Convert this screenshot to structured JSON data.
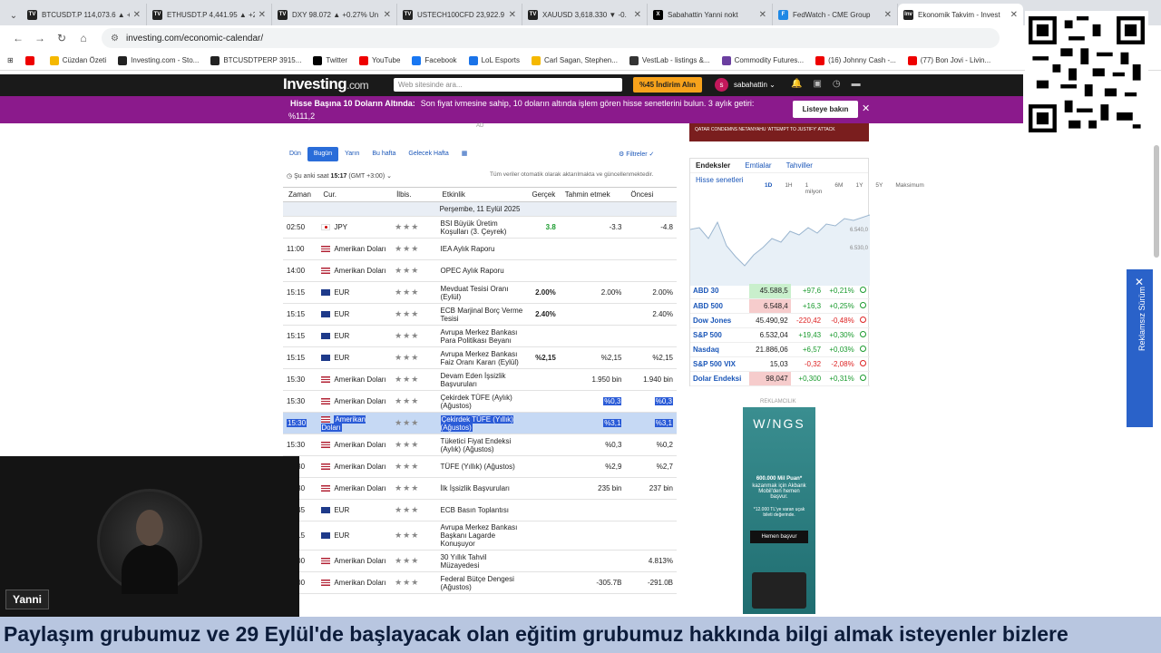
{
  "browser": {
    "tabs": [
      {
        "label": "BTCUSDT.P 114,073.6 ▲ +0.",
        "fav": "TV",
        "color": "#222"
      },
      {
        "label": "ETHUSDT.P 4,441.95 ▲ +2.",
        "fav": "TV",
        "color": "#222"
      },
      {
        "label": "DXY 98.072 ▲ +0.27% Un",
        "fav": "TV",
        "color": "#222"
      },
      {
        "label": "USTECH100CFD 23,922.9",
        "fav": "TV",
        "color": "#222"
      },
      {
        "label": "XAUUSD 3,618.330 ▼ -0.",
        "fav": "TV",
        "color": "#222"
      },
      {
        "label": "Sabahattin Yanni nokt",
        "fav": "X",
        "color": "#000"
      },
      {
        "label": "FedWatch - CME Group",
        "fav": "F",
        "color": "#1e88e5"
      },
      {
        "label": "Ekonomik Takvim - Invest",
        "fav": "Inv",
        "color": "#222"
      }
    ],
    "url": "investing.com/economic-calendar/",
    "bookmarks": [
      {
        "label": "",
        "color": "#e00"
      },
      {
        "label": "Cüzdan Özeti",
        "color": "#f5b800"
      },
      {
        "label": "Investing.com - Sto...",
        "color": "#222"
      },
      {
        "label": "BTCUSDTPERP 3915...",
        "color": "#222"
      },
      {
        "label": "Twitter",
        "color": "#000"
      },
      {
        "label": "YouTube",
        "color": "#e00"
      },
      {
        "label": "Facebook",
        "color": "#1877f2"
      },
      {
        "label": "LoL Esports",
        "color": "#1a73e8"
      },
      {
        "label": "Carl Sagan, Stephen...",
        "color": "#f5b800"
      },
      {
        "label": "VestLab - listings &...",
        "color": "#333"
      },
      {
        "label": "Commodity Futures...",
        "color": "#6b3fa0"
      },
      {
        "label": "(16) Johnny Cash -...",
        "color": "#e00"
      },
      {
        "label": "(77) Bon Jovi - Livin...",
        "color": "#e00"
      }
    ]
  },
  "header": {
    "logo": "Investing",
    "logo_suffix": ".com",
    "search_placeholder": "Web sitesinde ara...",
    "promo": "%45 İndirim Alın",
    "user_initial": "s",
    "user": "sabahattin ⌄"
  },
  "banner": {
    "title": "Hisse Başına 10 Doların Altında:",
    "text": "Son fiyat ivmesine sahip, 10 doların altında işlem gören hisse senetlerini bulun. 3 aylık getiri:",
    "value": "%111,2",
    "button": "Listeye bakın"
  },
  "calendar": {
    "ad_label": "AD",
    "filters": [
      "Dün",
      "Bugün",
      "Yarın",
      "Bu hafta",
      "Gelecek Hafta"
    ],
    "filter_button": "Filtreler",
    "clock_label": "Şu anki saat",
    "clock_time": "15:17",
    "timezone": "(GMT +3:00)",
    "note": "Tüm veriler otomatik olarak aktarılmakta ve güncellenmektedir.",
    "headers": [
      "Zaman",
      "Cur.",
      "İlbis.",
      "Etkinlik",
      "Gerçek",
      "Tahmin etmek",
      "Öncesi"
    ],
    "date": "Perşembe, 11 Eylül 2025",
    "rows": [
      {
        "time": "02:50",
        "flag": "jp",
        "cur": "JPY",
        "event": "BSI Büyük Üretim Koşulları (3. Çeyrek)",
        "actual": "3.8",
        "forecast": "-3.3",
        "previous": "-4.8",
        "green": true
      },
      {
        "time": "11:00",
        "flag": "us",
        "cur": "Amerikan Doları",
        "event": "IEA Aylık Raporu",
        "actual": "",
        "forecast": "",
        "previous": ""
      },
      {
        "time": "14:00",
        "flag": "us",
        "cur": "Amerikan Doları",
        "event": "OPEC Aylık Raporu",
        "actual": "",
        "forecast": "",
        "previous": ""
      },
      {
        "time": "15:15",
        "flag": "eu",
        "cur": "EUR",
        "event": "Mevduat Tesisi Oranı (Eylül)",
        "actual": "2.00%",
        "forecast": "2.00%",
        "previous": "2.00%"
      },
      {
        "time": "15:15",
        "flag": "eu",
        "cur": "EUR",
        "event": "ECB Marjinal Borç Verme Tesisi",
        "actual": "2.40%",
        "forecast": "",
        "previous": "2.40%"
      },
      {
        "time": "15:15",
        "flag": "eu",
        "cur": "EUR",
        "event": "Avrupa Merkez Bankası Para Politikası Beyanı",
        "actual": "",
        "forecast": "",
        "previous": ""
      },
      {
        "time": "15:15",
        "flag": "eu",
        "cur": "EUR",
        "event": "Avrupa Merkez Bankası Faiz Oranı Kararı (Eylül)",
        "actual": "%2,15",
        "forecast": "%2,15",
        "previous": "%2,15"
      },
      {
        "time": "15:30",
        "flag": "us",
        "cur": "Amerikan Doları",
        "event": "Devam Eden İşsizlik Başvuruları",
        "actual": "",
        "forecast": "1.950 bin",
        "previous": "1.940 bin"
      },
      {
        "time": "15:30",
        "flag": "us",
        "cur": "Amerikan Doları",
        "event": "Çekirdek TÜFE (Aylık) (Ağustos)",
        "actual": "",
        "forecast": "%0,3",
        "previous": "%0,3"
      },
      {
        "time": "15:30",
        "flag": "us",
        "cur": "Amerikan Doları",
        "event": "Çekirdek TÜFE (Yıllık) (Ağustos)",
        "actual": "",
        "forecast": "%3,1",
        "previous": "%3,1",
        "hl": true
      },
      {
        "time": "15:30",
        "flag": "us",
        "cur": "Amerikan Doları",
        "event": "Tüketici Fiyat Endeksi (Aylık) (Ağustos)",
        "actual": "",
        "forecast": "%0,3",
        "previous": "%0,2"
      },
      {
        "time": "15:30",
        "flag": "us",
        "cur": "Amerikan Doları",
        "event": "TÜFE (Yıllık) (Ağustos)",
        "actual": "",
        "forecast": "%2,9",
        "previous": "%2,7"
      },
      {
        "time": "15:30",
        "flag": "us",
        "cur": "Amerikan Doları",
        "event": "İlk İşsizlik Başvuruları",
        "actual": "",
        "forecast": "235 bin",
        "previous": "237 bin"
      },
      {
        "time": "15:45",
        "flag": "eu",
        "cur": "EUR",
        "event": "ECB Basın Toplantısı",
        "actual": "",
        "forecast": "",
        "previous": ""
      },
      {
        "time": "16:15",
        "flag": "eu",
        "cur": "EUR",
        "event": "Avrupa Merkez Bankası Başkanı Lagarde Konuşuyor",
        "actual": "",
        "forecast": "",
        "previous": ""
      },
      {
        "time": "20:00",
        "flag": "us",
        "cur": "Amerikan Doları",
        "event": "30 Yıllık Tahvil Müzayedesi",
        "actual": "",
        "forecast": "",
        "previous": "4.813%"
      },
      {
        "time": "21:00",
        "flag": "us",
        "cur": "Amerikan Doları",
        "event": "Federal Bütçe Dengesi (Ağustos)",
        "actual": "",
        "forecast": "-305.7B",
        "previous": "-291.0B"
      }
    ]
  },
  "right_panel": {
    "top_ad_text": "QATAR CONDEMNS NETANYAHU 'ATTEMPT TO JUSTIFY' ATTACK",
    "tabs": [
      "Endeksler",
      "Emtialar",
      "Tahviller"
    ],
    "sub": "Hisse senetleri",
    "ranges": [
      "1D",
      "1H",
      "1 milyon",
      "6M",
      "1Y",
      "5Y",
      "Maksimum"
    ],
    "y_labels": [
      "6.540,0",
      "6.530,0"
    ],
    "markets": [
      {
        "name": "ABD 30",
        "last": "45.588,5",
        "chg": "+97,6",
        "pct": "+0,21%",
        "up": true,
        "hl": "up"
      },
      {
        "name": "ABD 500",
        "last": "6.548,4",
        "chg": "+16,3",
        "pct": "+0,25%",
        "up": true,
        "hl": "dn"
      },
      {
        "name": "Dow Jones",
        "last": "45.490,92",
        "chg": "-220,42",
        "pct": "-0,48%",
        "up": false
      },
      {
        "name": "S&P 500",
        "last": "6.532,04",
        "chg": "+19,43",
        "pct": "+0,30%",
        "up": true
      },
      {
        "name": "Nasdaq",
        "last": "21.886,06",
        "chg": "+6,57",
        "pct": "+0,03%",
        "up": true
      },
      {
        "name": "S&P 500 VIX",
        "last": "15,03",
        "chg": "-0,32",
        "pct": "-2,08%",
        "up": false
      },
      {
        "name": "Dolar Endeksi",
        "last": "98,047",
        "chg": "+0,300",
        "pct": "+0,31%",
        "up": true,
        "hl": "dn"
      }
    ],
    "reklam": "REKLAMCILIK",
    "ad": {
      "brand": "W/NGS",
      "line1": "600.000 Mil Puan*",
      "line2": "kazanmak için Akbank Mobil'den hemen başvur.",
      "line3": "*12.000 TL'ye varan uçak bileti değerinde.",
      "button": "Hemen başvur"
    }
  },
  "side_widget": {
    "close": "✕",
    "label": "Reklamsız Sürüm"
  },
  "webcam": {
    "name": "Yanni"
  },
  "subtitle": "Paylaşım grubumuz ve 29 Eylül'de başlayacak olan eğitim grubumuz hakkında bilgi almak isteyenler bizlere"
}
